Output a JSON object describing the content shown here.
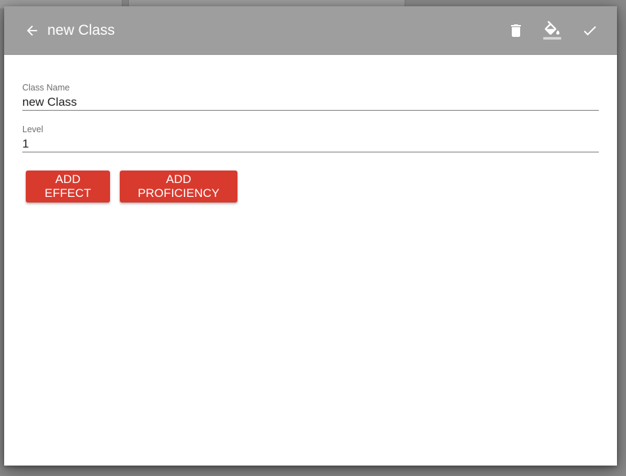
{
  "header": {
    "title": "new Class",
    "icons": {
      "back": "arrow-left-icon",
      "delete": "trash-icon",
      "paint": "paint-bucket-icon",
      "confirm": "check-icon"
    },
    "bar_color": "#9e9e9e"
  },
  "form": {
    "class_name": {
      "label": "Class Name",
      "value": "new Class"
    },
    "level": {
      "label": "Level",
      "value": "1"
    }
  },
  "actions": {
    "add_effect": "ADD EFFECT",
    "add_proficiency": "ADD PROFICIENCY",
    "button_color": "#d83a2e"
  }
}
